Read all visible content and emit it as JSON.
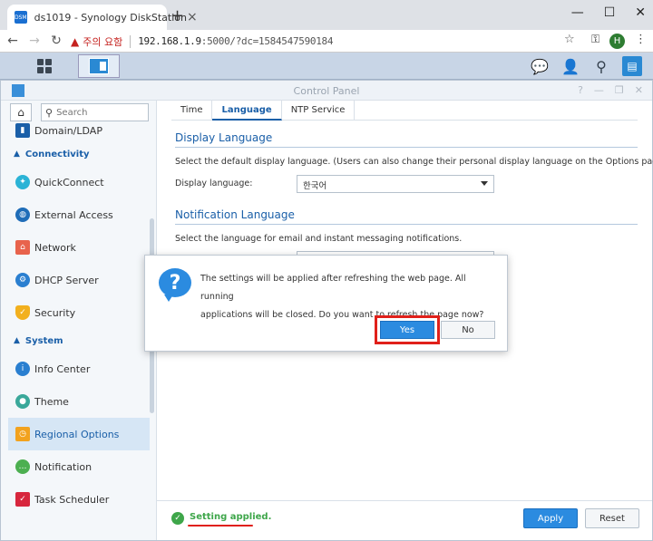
{
  "browser": {
    "tab_title": "ds1019 - Synology DiskStation",
    "favicon_text": "DSM",
    "tab_close": "×",
    "new_tab": "+",
    "window_controls": [
      "—",
      "☐",
      "✕"
    ],
    "warning_text": "주의 요함",
    "url_host": "192.168.1.9",
    "url_rest": ":5000/?dc=1584547590184",
    "profile_initial": "H"
  },
  "control_panel": {
    "title": "Control Panel",
    "search_placeholder": "Search"
  },
  "sidebar": {
    "top_item": "Domain/LDAP",
    "connectivity_label": "Connectivity",
    "connectivity_items": [
      {
        "label": "QuickConnect",
        "icon": "quickconnect-icon"
      },
      {
        "label": "External Access",
        "icon": "globe-icon"
      },
      {
        "label": "Network",
        "icon": "house-icon"
      },
      {
        "label": "DHCP Server",
        "icon": "network-icon"
      },
      {
        "label": "Security",
        "icon": "shield-icon"
      }
    ],
    "system_label": "System",
    "system_items": [
      {
        "label": "Info Center",
        "icon": "info-icon"
      },
      {
        "label": "Theme",
        "icon": "palette-icon"
      },
      {
        "label": "Regional Options",
        "icon": "regional-icon",
        "active": true
      },
      {
        "label": "Notification",
        "icon": "chat-icon"
      },
      {
        "label": "Task Scheduler",
        "icon": "calendar-icon"
      }
    ]
  },
  "tabs": [
    "Time",
    "Language",
    "NTP Service"
  ],
  "active_tab": "Language",
  "display_language": {
    "heading": "Display Language",
    "description": "Select the default display language. (Users can also change their personal display language on the Options page.)",
    "label": "Display language:",
    "value": "한국어"
  },
  "notification_language": {
    "heading": "Notification Language",
    "description": "Select the language for email and instant messaging notifications."
  },
  "status": {
    "text": "Setting applied."
  },
  "footer": {
    "apply": "Apply",
    "reset": "Reset"
  },
  "dialog": {
    "message_line1": "The settings will be applied after refreshing the web page. All running",
    "message_line2": "applications will be closed. Do you want to refresh the page now?",
    "yes": "Yes",
    "no": "No"
  },
  "colors": {
    "accent": "#2b8be0",
    "highlight": "#e0201a",
    "success": "#3ea64a"
  }
}
